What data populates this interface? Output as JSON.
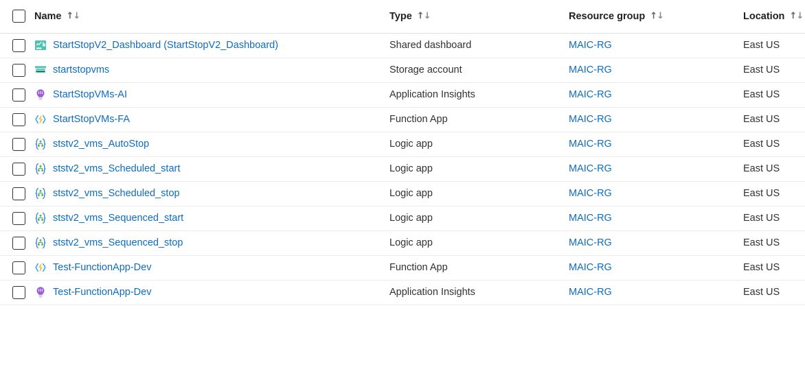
{
  "table": {
    "columns": [
      {
        "key": "name",
        "label": "Name",
        "sortable": true
      },
      {
        "key": "type",
        "label": "Type",
        "sortable": true
      },
      {
        "key": "resource_group",
        "label": "Resource group",
        "sortable": true
      },
      {
        "key": "location",
        "label": "Location",
        "sortable": true
      }
    ],
    "sort_arrows": {
      "up": "↑",
      "down": "↓"
    },
    "rows": [
      {
        "name": "StartStopV2_Dashboard (StartStopV2_Dashboard)",
        "icon": "shared-dashboard-icon",
        "type": "Shared dashboard",
        "resource_group": "MAIC-RG",
        "location": "East US",
        "selected": false
      },
      {
        "name": "startstopvms",
        "icon": "storage-account-icon",
        "type": "Storage account",
        "resource_group": "MAIC-RG",
        "location": "East US",
        "selected": false
      },
      {
        "name": "StartStopVMs-AI",
        "icon": "application-insights-icon",
        "type": "Application Insights",
        "resource_group": "MAIC-RG",
        "location": "East US",
        "selected": false
      },
      {
        "name": "StartStopVMs-FA",
        "icon": "function-app-icon",
        "type": "Function App",
        "resource_group": "MAIC-RG",
        "location": "East US",
        "selected": false
      },
      {
        "name": "ststv2_vms_AutoStop",
        "icon": "logic-app-icon",
        "type": "Logic app",
        "resource_group": "MAIC-RG",
        "location": "East US",
        "selected": false
      },
      {
        "name": "ststv2_vms_Scheduled_start",
        "icon": "logic-app-icon",
        "type": "Logic app",
        "resource_group": "MAIC-RG",
        "location": "East US",
        "selected": false
      },
      {
        "name": "ststv2_vms_Scheduled_stop",
        "icon": "logic-app-icon",
        "type": "Logic app",
        "resource_group": "MAIC-RG",
        "location": "East US",
        "selected": false
      },
      {
        "name": "ststv2_vms_Sequenced_start",
        "icon": "logic-app-icon",
        "type": "Logic app",
        "resource_group": "MAIC-RG",
        "location": "East US",
        "selected": false
      },
      {
        "name": "ststv2_vms_Sequenced_stop",
        "icon": "logic-app-icon",
        "type": "Logic app",
        "resource_group": "MAIC-RG",
        "location": "East US",
        "selected": false
      },
      {
        "name": "Test-FunctionApp-Dev",
        "icon": "function-app-icon",
        "type": "Function App",
        "resource_group": "MAIC-RG",
        "location": "East US",
        "selected": false
      },
      {
        "name": "Test-FunctionApp-Dev",
        "icon": "application-insights-icon",
        "type": "Application Insights",
        "resource_group": "MAIC-RG",
        "location": "East US",
        "selected": false
      }
    ]
  },
  "colors": {
    "link": "#0f6cbd",
    "text": "#323130",
    "row_border": "#edebe9",
    "header_border": "#e1dfdd",
    "dashboard_teal": "#4cc3b0",
    "storage_teal": "#36b3a5",
    "insights_purple": "#9b5cd6",
    "function_yellow": "#f2c230",
    "function_blue": "#36a9f5",
    "logic_green": "#59b45f",
    "logic_blue": "#2f7fd4"
  }
}
